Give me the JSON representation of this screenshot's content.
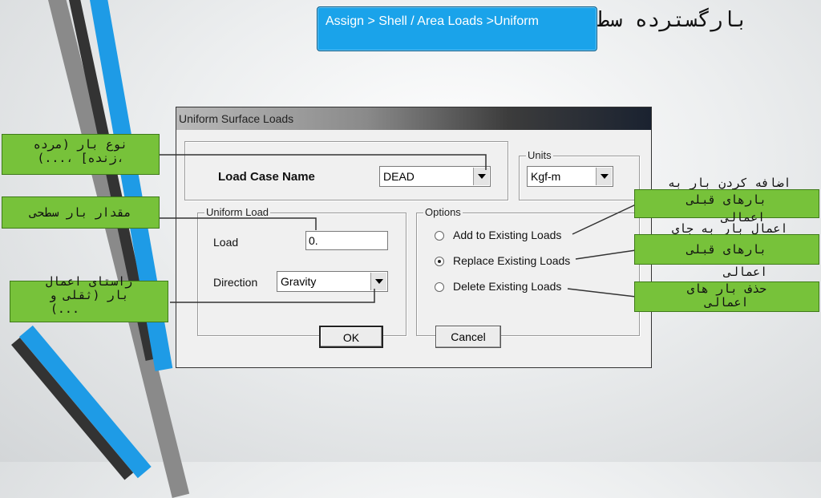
{
  "slide": {
    "title_fa": "بارگسترده سط",
    "menu_path": "Assign > Shell / Area Loads >Uniform"
  },
  "dialog": {
    "title": "Uniform Surface Loads",
    "load_case_label": "Load Case Name",
    "load_case_value": "DEAD",
    "units_legend": "Units",
    "units_value": "Kgf-m",
    "uniform_load_legend": "Uniform Load",
    "load_label": "Load",
    "load_value": "0.",
    "direction_label": "Direction",
    "direction_value": "Gravity",
    "options_legend": "Options",
    "options": [
      {
        "label": "Add to Existing Loads",
        "selected": false
      },
      {
        "label": "Replace Existing Loads",
        "selected": true
      },
      {
        "label": "Delete Existing Loads",
        "selected": false
      }
    ],
    "ok_label": "OK",
    "cancel_label": "Cancel"
  },
  "annotations": {
    "load_type_line1": "نوع بار (مرده",
    "load_type_line2": "،زنده] ،...)",
    "load_amount": "مقدار بار سطحی",
    "direction_line1": "راستای اعمال",
    "direction_line2": "بار (ثقلی و",
    "direction_line3": "...)",
    "add_over_line1": "اضافه کردن بار به",
    "add_line1": "بارهای قبلی",
    "add_line2": "اعمالی",
    "replace_over": "اعمال بار به جای",
    "replace_line1": "بارهای قبلی",
    "replace_line2": "اعمالی",
    "delete_line1": "حذف بار های",
    "delete_line2": "اعمالی"
  },
  "colors": {
    "note_green": "#77c23a",
    "path_blue": "#1aa3ea",
    "stripe_blue": "#1e9be6",
    "stripe_dark": "#333333"
  }
}
